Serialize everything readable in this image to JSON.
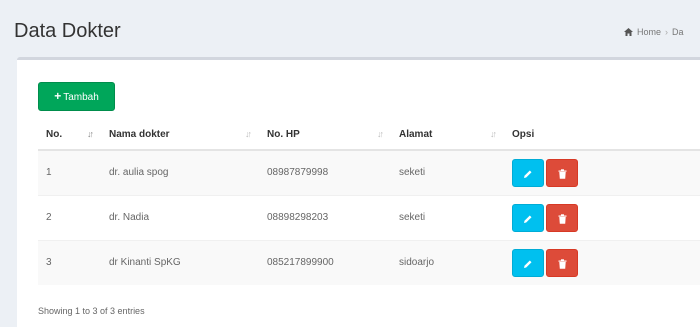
{
  "header": {
    "title": "Data Dokter",
    "breadcrumb": [
      "Home",
      "Da"
    ]
  },
  "toolbar": {
    "add_label": "Tambah",
    "add_icon": "plus-icon"
  },
  "table": {
    "columns": [
      "No.",
      "Nama dokter",
      "No. HP",
      "Alamat",
      "Opsi"
    ],
    "rows": [
      {
        "no": "1",
        "nama": "dr. aulia spog",
        "hp": "08987879998",
        "alamat": "seketi"
      },
      {
        "no": "2",
        "nama": "dr. Nadia",
        "hp": "08898298203",
        "alamat": "seketi"
      },
      {
        "no": "3",
        "nama": "dr Kinanti SpKG",
        "hp": "085217899900",
        "alamat": "sidoarjo"
      }
    ],
    "info": "Showing 1 to 3 of 3 entries"
  },
  "colors": {
    "add": "#00a65a",
    "edit": "#00c0ef",
    "delete": "#dd4b39"
  },
  "icons": {
    "edit": "pencil-icon",
    "delete": "trash-icon",
    "home": "home-icon"
  }
}
